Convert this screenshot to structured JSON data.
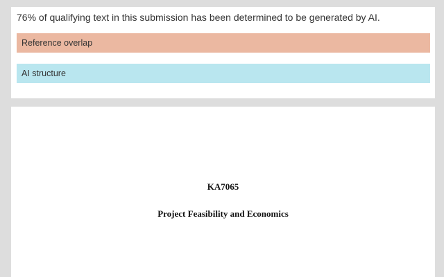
{
  "summary": {
    "text": "76% of qualifying text in this submission has been determined to be generated by AI.",
    "categories": [
      {
        "label": "Reference overlap",
        "color": "#ebb8a1"
      },
      {
        "label": "AI structure",
        "color": "#b9e6ef"
      }
    ]
  },
  "document": {
    "code": "KA7065",
    "title": "Project Feasibility and Economics"
  }
}
